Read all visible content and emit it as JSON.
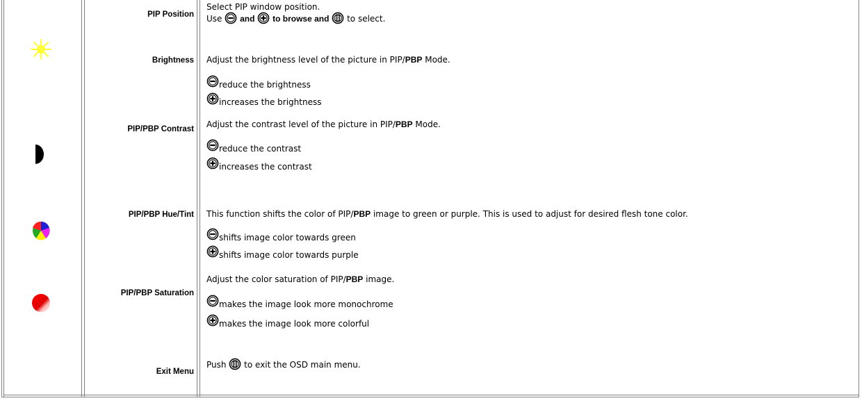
{
  "rows": {
    "pip_position": {
      "label": "PIP Position",
      "line1": "Select PIP window position.",
      "use": "Use",
      "and": "and",
      "to_browse": "to browse and",
      "to_select": "to select."
    },
    "brightness": {
      "label": "Brightness",
      "line1_pre": "Adjust the brightness level of the picture in PIP/",
      "pbp": "PBP",
      "line1_post": " Mode.",
      "minus_text": "reduce the brightness",
      "plus_text": "increases the brightness"
    },
    "contrast": {
      "label": "PIP/PBP Contrast",
      "line1_pre": "Adjust the contrast level of the picture in PIP/",
      "pbp": "PBP",
      "line1_post": " Mode.",
      "minus_text": "reduce the contrast",
      "plus_text": "increases the contrast"
    },
    "hue": {
      "label": "PIP/PBP Hue/Tint",
      "line1_pre": "This function shifts the color of PIP/",
      "pbp": "PBP",
      "line1_post": " image to green or purple. This is used to adjust for desired flesh tone color.",
      "minus_text": "shifts image color towards green",
      "plus_text": "shifts image color towards purple"
    },
    "saturation": {
      "label": "PIP/PBP Saturation",
      "line1_pre": "Adjust the color saturation of PIP/",
      "pbp": "PBP",
      "line1_post": " image.",
      "minus_text": "makes the image look more monochrome",
      "plus_text": "makes the image look more colorful"
    },
    "exit": {
      "label": "Exit Menu",
      "push": "Push",
      "rest": "to exit the OSD main menu."
    }
  },
  "icons": {
    "brightness": "sun-icon",
    "contrast": "half-moon-icon",
    "hue": "color-wheel-icon",
    "saturation": "red-ball-icon",
    "minus": "minus-button-icon",
    "plus": "plus-button-icon",
    "menu": "menu-button-icon"
  },
  "colors": {
    "sun": "#ffff33",
    "border": "#808080"
  }
}
